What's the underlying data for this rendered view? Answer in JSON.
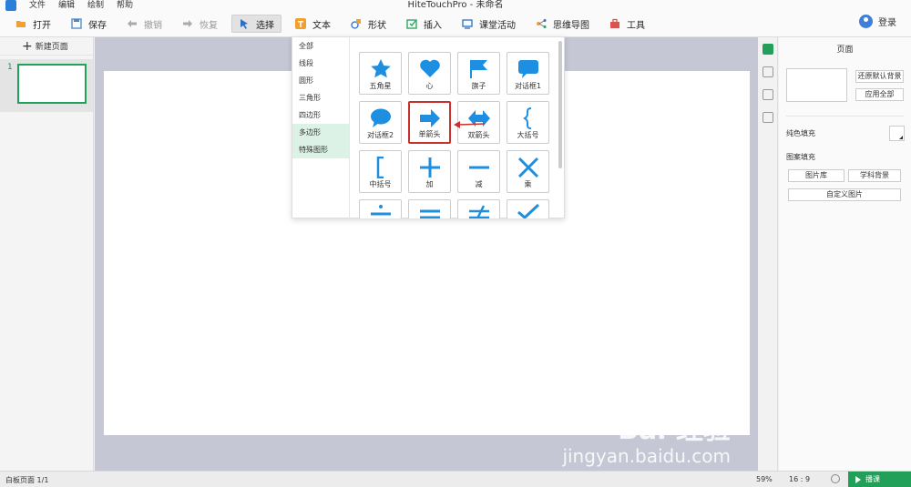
{
  "window": {
    "title": "HiteTouchPro - 未命名"
  },
  "menu": [
    "文件",
    "编辑",
    "绘制",
    "帮助"
  ],
  "toolbar": {
    "open": "打开",
    "save": "保存",
    "undo": "撤销",
    "redo": "恢复",
    "select": "选择",
    "text": "文本",
    "shape": "形状",
    "insert": "插入",
    "class_activity": "课堂活动",
    "mindmap": "思维导图",
    "tools": "工具",
    "login": "登录"
  },
  "left": {
    "new_page": "新建页面",
    "page_number": "1"
  },
  "shape_menu": {
    "categories": [
      "全部",
      "线段",
      "圆形",
      "三角形",
      "四边形",
      "多边形",
      "特殊图形"
    ],
    "shapes": [
      "五角星",
      "心",
      "旗子",
      "对话框1",
      "对话框2",
      "单箭头",
      "双箭头",
      "大括号",
      "中括号",
      "加",
      "减",
      "乘"
    ]
  },
  "right_panel": {
    "title": "页面",
    "reset_bg": "还原默认背景",
    "apply_all": "应用全部",
    "solid_fill": "纯色填充",
    "pattern_fill": "图案填充",
    "gallery": "图片库",
    "subject_bg": "学科背景",
    "custom_image": "自定义图片"
  },
  "status": {
    "page_info": "白板页面 1/1",
    "zoom": "59%",
    "ratio": "16 : 9",
    "present": "播课"
  },
  "watermark": {
    "main": "Bai 经验",
    "sub": "jingyan.baidu.com"
  },
  "colors": {
    "accent": "#22a05a",
    "shape_blue": "#1e8fe0",
    "highlight": "#c9302c"
  }
}
